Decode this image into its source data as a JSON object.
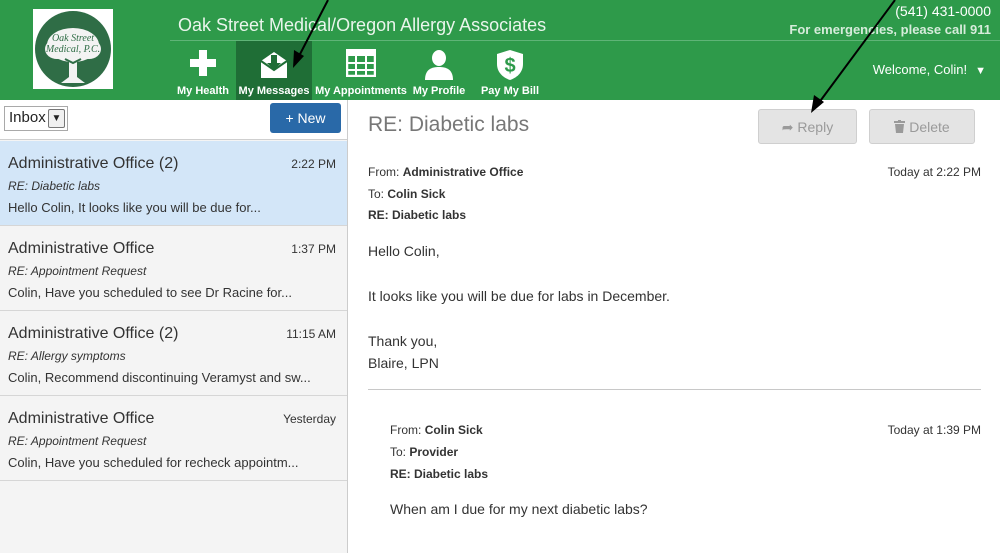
{
  "header": {
    "practice_name": "Oak Street Medical/Oregon Allergy Associates",
    "logo_text_line1": "Oak Street",
    "logo_text_line2": "Medical, P.C.",
    "phone": "(541) 431-0000",
    "emergency": "For emergencies, please call 911",
    "welcome": "Welcome, Colin!",
    "nav": [
      {
        "label": "My Health",
        "icon": "plus-icon"
      },
      {
        "label": "My Messages",
        "icon": "envelope-download-icon"
      },
      {
        "label": "My Appointments",
        "icon": "calendar-grid-icon"
      },
      {
        "label": "My Profile",
        "icon": "person-icon"
      },
      {
        "label": "Pay My Bill",
        "icon": "dollar-shield-icon"
      }
    ]
  },
  "toolbar": {
    "folder": "Inbox",
    "new_label": "New"
  },
  "messages": [
    {
      "sender": "Administrative Office (2)",
      "time": "2:22 PM",
      "subject": "RE: Diabetic labs",
      "preview": "Hello Colin, It looks like you will be due for..."
    },
    {
      "sender": "Administrative Office",
      "time": "1:37 PM",
      "subject": "RE: Appointment Request",
      "preview": "Colin, Have you scheduled to see Dr Racine for..."
    },
    {
      "sender": "Administrative Office (2)",
      "time": "11:15 AM",
      "subject": "RE: Allergy symptoms",
      "preview": "Colin, Recommend discontinuing Veramyst and sw..."
    },
    {
      "sender": "Administrative Office",
      "time": "Yesterday",
      "subject": "RE: Appointment Request",
      "preview": "Colin, Have you scheduled for recheck appointm..."
    }
  ],
  "detail": {
    "subject": "RE: Diabetic labs",
    "reply_label": "Reply",
    "delete_label": "Delete",
    "message1": {
      "from_label": "From:",
      "from": "Administrative Office",
      "to_label": "To:",
      "to": "Colin Sick",
      "subject": "RE: Diabetic labs",
      "date": "Today at 2:22 PM",
      "greeting": "Hello Colin,",
      "body": "It looks like you will be due for labs in December.",
      "closing": "Thank you,",
      "signature": "Blaire, LPN"
    },
    "message2": {
      "from_label": "From:",
      "from": "Colin Sick",
      "to_label": "To:",
      "to": "Provider",
      "subject": "RE: Diabetic labs",
      "date": "Today at 1:39 PM",
      "body": "When am I due for my next diabetic labs?"
    }
  },
  "colors": {
    "header_green": "#2e9a4a",
    "active_nav": "#1f6e36",
    "new_button": "#2969a8",
    "selected_row": "#d3e6f8"
  }
}
